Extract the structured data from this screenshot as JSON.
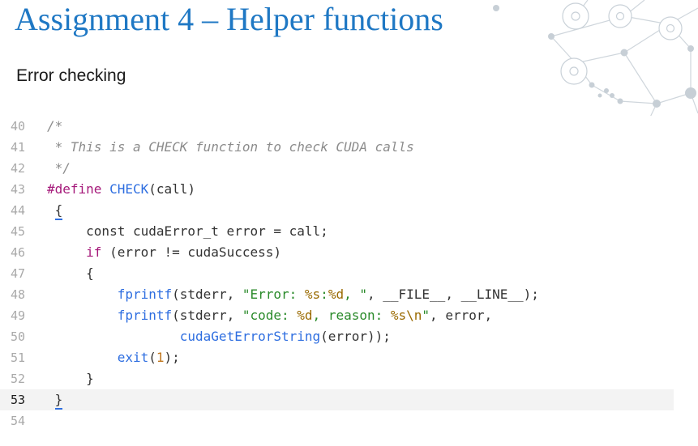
{
  "slide": {
    "title": "Assignment 4 – Helper functions",
    "subtitle": "Error checking"
  },
  "code": {
    "current_line": "53",
    "lines": [
      {
        "num": "40",
        "tokens": [
          {
            "t": "/*",
            "c": "comment"
          }
        ]
      },
      {
        "num": "41",
        "tokens": [
          {
            "t": " * This is a CHECK function to check CUDA calls",
            "c": "comment"
          }
        ]
      },
      {
        "num": "42",
        "tokens": [
          {
            "t": " */",
            "c": "comment"
          }
        ]
      },
      {
        "num": "43",
        "tokens": [
          {
            "t": "#define",
            "c": "pre"
          },
          {
            "t": " ",
            "c": ""
          },
          {
            "t": "CHECK",
            "c": "macro"
          },
          {
            "t": "(call)",
            "c": ""
          }
        ]
      },
      {
        "num": "44",
        "tokens": [
          {
            "t": " ",
            "c": ""
          },
          {
            "t": "{",
            "c": "brace"
          }
        ]
      },
      {
        "num": "45",
        "tokens": [
          {
            "t": "     const cudaError_t error = call;",
            "c": ""
          }
        ]
      },
      {
        "num": "46",
        "tokens": [
          {
            "t": "     ",
            "c": ""
          },
          {
            "t": "if",
            "c": "kw"
          },
          {
            "t": " (error != cudaSuccess)",
            "c": ""
          }
        ]
      },
      {
        "num": "47",
        "tokens": [
          {
            "t": "     {",
            "c": ""
          }
        ]
      },
      {
        "num": "48",
        "tokens": [
          {
            "t": "         ",
            "c": ""
          },
          {
            "t": "fprintf",
            "c": "fn"
          },
          {
            "t": "(stderr, ",
            "c": ""
          },
          {
            "t": "\"Error: ",
            "c": "str"
          },
          {
            "t": "%s",
            "c": "fmt"
          },
          {
            "t": ":",
            "c": "str"
          },
          {
            "t": "%d",
            "c": "fmt"
          },
          {
            "t": ", \"",
            "c": "str"
          },
          {
            "t": ", __FILE__, __LINE__);",
            "c": ""
          }
        ]
      },
      {
        "num": "49",
        "tokens": [
          {
            "t": "         ",
            "c": ""
          },
          {
            "t": "fprintf",
            "c": "fn"
          },
          {
            "t": "(stderr, ",
            "c": ""
          },
          {
            "t": "\"code: ",
            "c": "str"
          },
          {
            "t": "%d",
            "c": "fmt"
          },
          {
            "t": ", reason: ",
            "c": "str"
          },
          {
            "t": "%s",
            "c": "fmt"
          },
          {
            "t": "\\n",
            "c": "fmt"
          },
          {
            "t": "\"",
            "c": "str"
          },
          {
            "t": ", error,",
            "c": ""
          }
        ]
      },
      {
        "num": "50",
        "tokens": [
          {
            "t": "                 ",
            "c": ""
          },
          {
            "t": "cudaGetErrorString",
            "c": "fn"
          },
          {
            "t": "(error));",
            "c": ""
          }
        ]
      },
      {
        "num": "51",
        "tokens": [
          {
            "t": "         ",
            "c": ""
          },
          {
            "t": "exit",
            "c": "fn"
          },
          {
            "t": "(",
            "c": ""
          },
          {
            "t": "1",
            "c": "num"
          },
          {
            "t": ");",
            "c": ""
          }
        ]
      },
      {
        "num": "52",
        "tokens": [
          {
            "t": "     }",
            "c": ""
          }
        ]
      },
      {
        "num": "53",
        "tokens": [
          {
            "t": " ",
            "c": ""
          },
          {
            "t": "}",
            "c": "brace"
          }
        ]
      },
      {
        "num": "54",
        "tokens": []
      }
    ]
  },
  "colors": {
    "title": "#1f78c4",
    "keyword": "#a5197a",
    "function": "#2e6ee0",
    "string": "#2a8a2a",
    "format": "#9a6a00",
    "number": "#c0771e",
    "comment": "#8c8c8c",
    "line_number": "#a9a9a9",
    "current_line_bg": "#f3f3f3",
    "decoration": "#c7cfd6"
  },
  "decoration": {
    "icon": "network-molecule-icon"
  }
}
